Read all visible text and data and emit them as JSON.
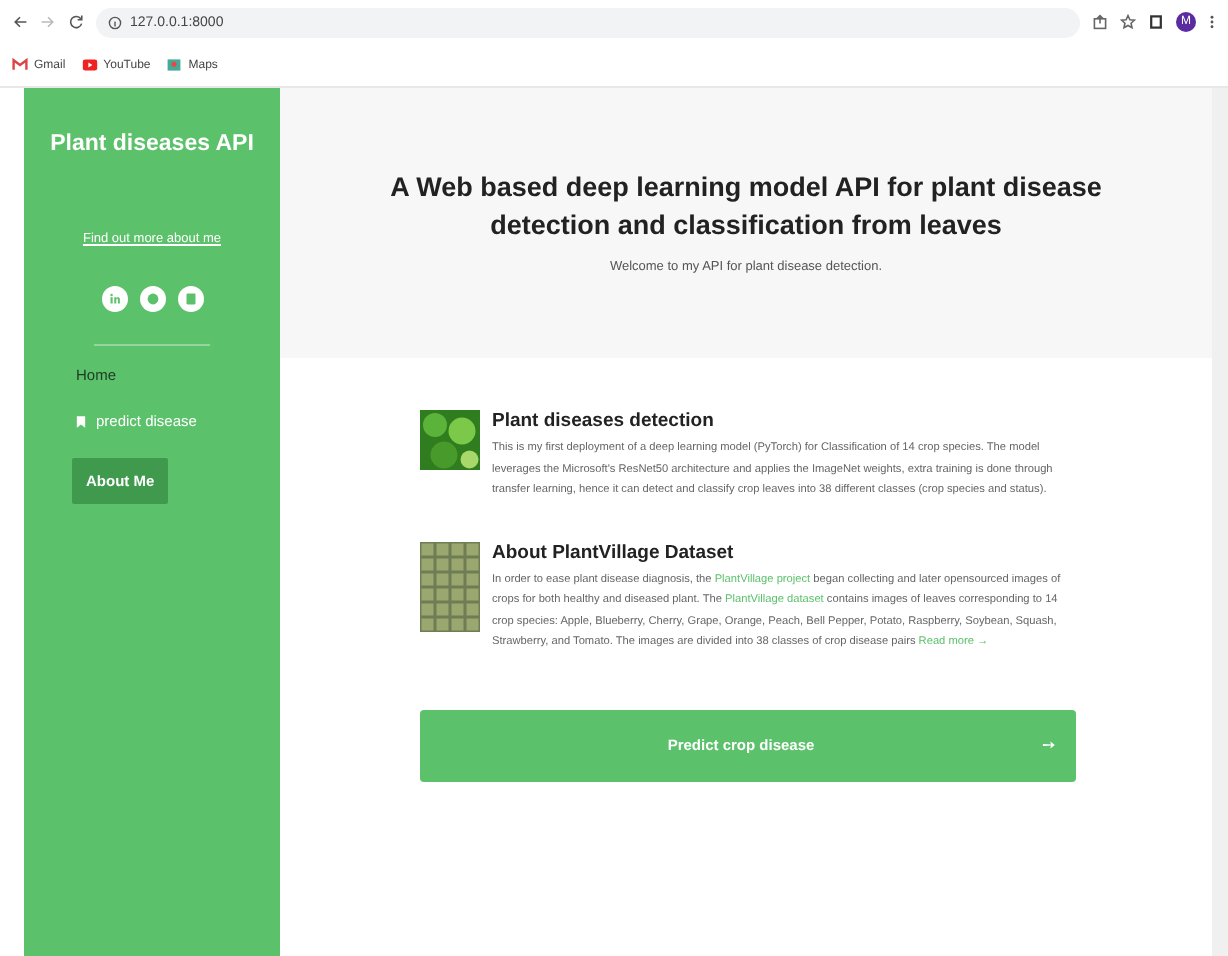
{
  "browser": {
    "url": "127.0.0.1:8000",
    "avatar": "M",
    "bookmarks": [
      {
        "label": "Gmail"
      },
      {
        "label": "YouTube"
      },
      {
        "label": "Maps"
      }
    ]
  },
  "sidebar": {
    "title": "Plant diseases API",
    "link": "Find out more about me",
    "nav": [
      {
        "label": "Home",
        "kind": "text",
        "selected": false
      },
      {
        "label": "predict disease",
        "kind": "bookmark",
        "selected": false
      },
      {
        "label": "About Me",
        "kind": "text",
        "selected": true
      }
    ]
  },
  "header": {
    "title": "A Web based deep learning model API for plant disease detection and classification from leaves",
    "subtitle": "Welcome to my API for plant disease detection."
  },
  "features": [
    {
      "title": "Plant diseases detection",
      "body": [
        {
          "text": "This is my first deployment of a deep learning model (PyTorch) for Classification of 14 crop species. The model leverages the Microsoft's ResNet50 architecture and applies the ImageNet weights, extra training is done through transfer learning, hence it can detect and classify crop leaves into 38 different classes (crop species and status).",
          "link": false
        }
      ]
    },
    {
      "title": "About PlantVillage Dataset",
      "body": [
        {
          "text": "In order to ease plant disease diagnosis, the ",
          "link": false
        },
        {
          "text": "PlantVillage project",
          "link": true
        },
        {
          "text": " began collecting and later opensourced images of crops for both healthy and diseased plant. The ",
          "link": false
        },
        {
          "text": "PlantVillage dataset",
          "link": true
        },
        {
          "text": " contains images of leaves corresponding to 14 crop species: Apple, Blueberry, Cherry, Grape, Orange, Peach, Bell Pepper, Potato, Raspberry, Soybean, Squash, Strawberry, and Tomato. The images are divided into 38 classes of crop disease pairs ",
          "link": false
        },
        {
          "text": "Read more →",
          "link": true
        }
      ]
    }
  ],
  "action": {
    "label": "Predict crop disease",
    "arrow": "➙"
  }
}
